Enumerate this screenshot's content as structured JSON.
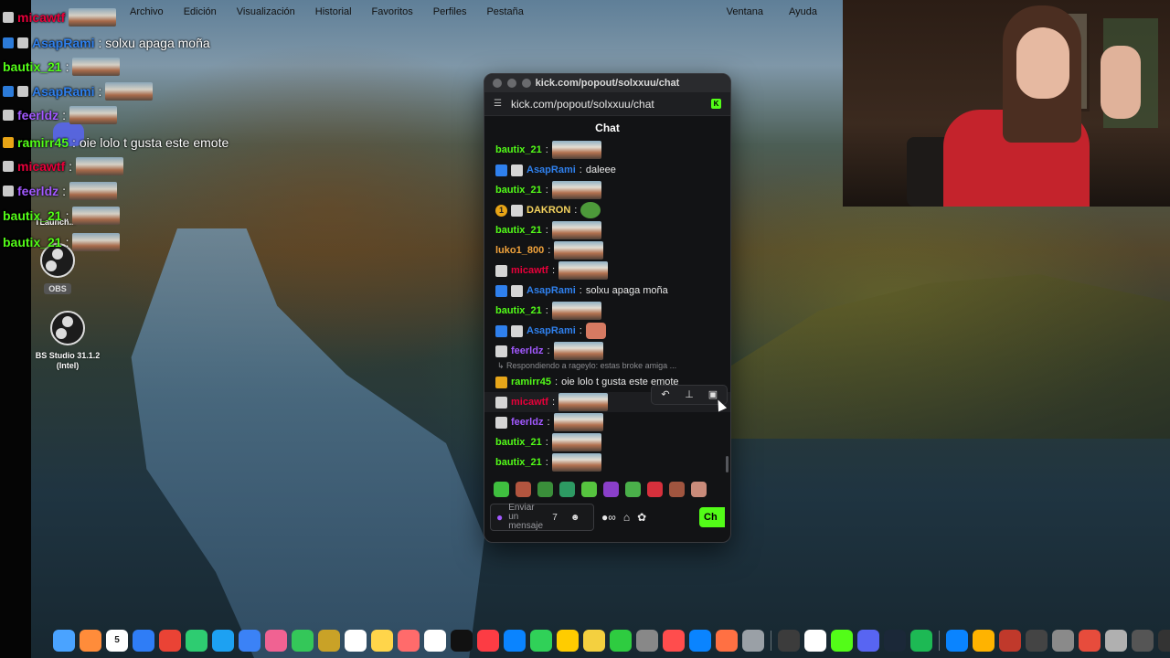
{
  "menubar": {
    "items": [
      "Archivo",
      "Edición",
      "Visualización",
      "Historial",
      "Favoritos",
      "Perfiles",
      "Pestaña"
    ],
    "right_items": [
      "Ventana",
      "Ayuda"
    ]
  },
  "overlay_chat": [
    {
      "user": "micawtf",
      "color": "#e8003a",
      "badges": [
        "gray"
      ],
      "text": "",
      "emote": true
    },
    {
      "user": "AsapRami",
      "color": "#2f80ed",
      "badges": [
        "blue",
        "gray"
      ],
      "text": ": solxu apaga moña",
      "emote": false
    },
    {
      "user": "bautix_21",
      "color": "#53fc18",
      "badges": [],
      "text": ":",
      "emote": true
    },
    {
      "user": "AsapRami",
      "color": "#2f80ed",
      "badges": [
        "blue",
        "gray"
      ],
      "text": ":",
      "emote": true
    },
    {
      "user": "feerldz",
      "color": "#a259ff",
      "badges": [
        "gray"
      ],
      "text": ":",
      "emote": true
    },
    {
      "user": "ramirr45",
      "color": "#53fc18",
      "badges": [
        "yellow"
      ],
      "text": ": oie lolo t gusta este emote",
      "emote": false
    },
    {
      "user": "micawtf",
      "color": "#e8003a",
      "badges": [
        "gray"
      ],
      "text": ":",
      "emote": true
    },
    {
      "user": "feerldz",
      "color": "#a259ff",
      "badges": [
        "gray"
      ],
      "text": ":",
      "emote": true
    },
    {
      "user": "bautix_21",
      "color": "#53fc18",
      "badges": [],
      "text": ":",
      "emote": true
    },
    {
      "user": "bautix_21",
      "color": "#53fc18",
      "badges": [],
      "text": ":",
      "emote": true
    }
  ],
  "desktop": {
    "tlaunch_label": "TLaunch...",
    "obs_tag": "OBS",
    "obs2_label": "BS Studio 31.1.2 (Intel)"
  },
  "window": {
    "title": "kick.com/popout/solxxuu/chat",
    "url": "kick.com/popout/solxxuu/chat",
    "header": "Chat"
  },
  "messages": [
    {
      "user": "bautix_21",
      "color": "#53fc18",
      "badges": [],
      "text": "",
      "emote": "image"
    },
    {
      "user": "AsapRami",
      "color": "#2f80ed",
      "badges": [
        "blue",
        "gray"
      ],
      "text": "daleee",
      "emote": ""
    },
    {
      "user": "bautix_21",
      "color": "#53fc18",
      "badges": [],
      "text": "",
      "emote": "image"
    },
    {
      "user": "DAKRON",
      "color": "#f4d35e",
      "badges": [
        "gold",
        "gray"
      ],
      "text": "",
      "emote": "frog"
    },
    {
      "user": "bautix_21",
      "color": "#53fc18",
      "badges": [],
      "text": "",
      "emote": "image"
    },
    {
      "user": "luko1_800",
      "color": "#f0a23b",
      "badges": [],
      "text": "",
      "emote": "image"
    },
    {
      "user": "micawtf",
      "color": "#e8003a",
      "badges": [
        "gray"
      ],
      "text": "",
      "emote": "image"
    },
    {
      "user": "AsapRami",
      "color": "#2f80ed",
      "badges": [
        "blue",
        "gray"
      ],
      "text": "solxu apaga moña",
      "emote": ""
    },
    {
      "user": "bautix_21",
      "color": "#53fc18",
      "badges": [],
      "text": "",
      "emote": "image"
    },
    {
      "user": "AsapRami",
      "color": "#2f80ed",
      "badges": [
        "blue",
        "gray"
      ],
      "text": "",
      "emote": "hand"
    },
    {
      "user": "feerldz",
      "color": "#a259ff",
      "badges": [
        "gray"
      ],
      "text": "",
      "emote": "image"
    },
    {
      "user": "ramirr45",
      "color": "#53fc18",
      "badges": [
        "orange"
      ],
      "text": "oie lolo t gusta este emote",
      "emote": ""
    },
    {
      "user": "micawtf",
      "color": "#e8003a",
      "badges": [
        "gray"
      ],
      "text": "",
      "emote": "image"
    },
    {
      "user": "feerldz",
      "color": "#a259ff",
      "badges": [
        "gray"
      ],
      "text": "",
      "emote": "image"
    },
    {
      "user": "bautix_21",
      "color": "#53fc18",
      "badges": [],
      "text": "",
      "emote": "image"
    },
    {
      "user": "bautix_21",
      "color": "#53fc18",
      "badges": [],
      "text": "",
      "emote": "image"
    }
  ],
  "reply_context": "Respondiendo a rageylo: estas broke amiga ...",
  "hover_actions": [
    "reply-icon",
    "pin-icon",
    "delete-icon"
  ],
  "emote_bar_colors": [
    "#3fbf3f",
    "#b2553f",
    "#3a8f3a",
    "#2d9a63",
    "#56c43f",
    "#8a3fc9",
    "#4ab04a",
    "#d6303c",
    "#a0553f",
    "#c98b7a"
  ],
  "composer": {
    "placeholder": "Enviar un mensaje",
    "send_label": "Ch"
  },
  "dock": {
    "calendar_day": "5",
    "colors": [
      "#4aa3ff",
      "#ff8c3a",
      "#ffffff",
      "#2f7df6",
      "#ea4335",
      "#2ecc71",
      "#1da1f2",
      "#3b82f6",
      "#f06292",
      "#34c759",
      "#c9a227",
      "#ffffff",
      "#ffd54a",
      "#ff6b6b",
      "#ffffff",
      "#111111",
      "#fc3c44",
      "#0a84ff",
      "#30d158",
      "#ffcc00",
      "#f4d03f",
      "#2ecc40",
      "#888888",
      "#ff4d4d",
      "#0a84ff",
      "#ff7043",
      "#9aa0a6",
      "#3c3c3c",
      "#ffffff",
      "#53fc18",
      "#5865f2",
      "#1b2838",
      "#1db954",
      "#0a84ff",
      "#ffb300",
      "#c0392b",
      "#444444",
      "#8a8a8a",
      "#e74c3c",
      "#b0b0b0",
      "#555555",
      "#333333"
    ]
  }
}
